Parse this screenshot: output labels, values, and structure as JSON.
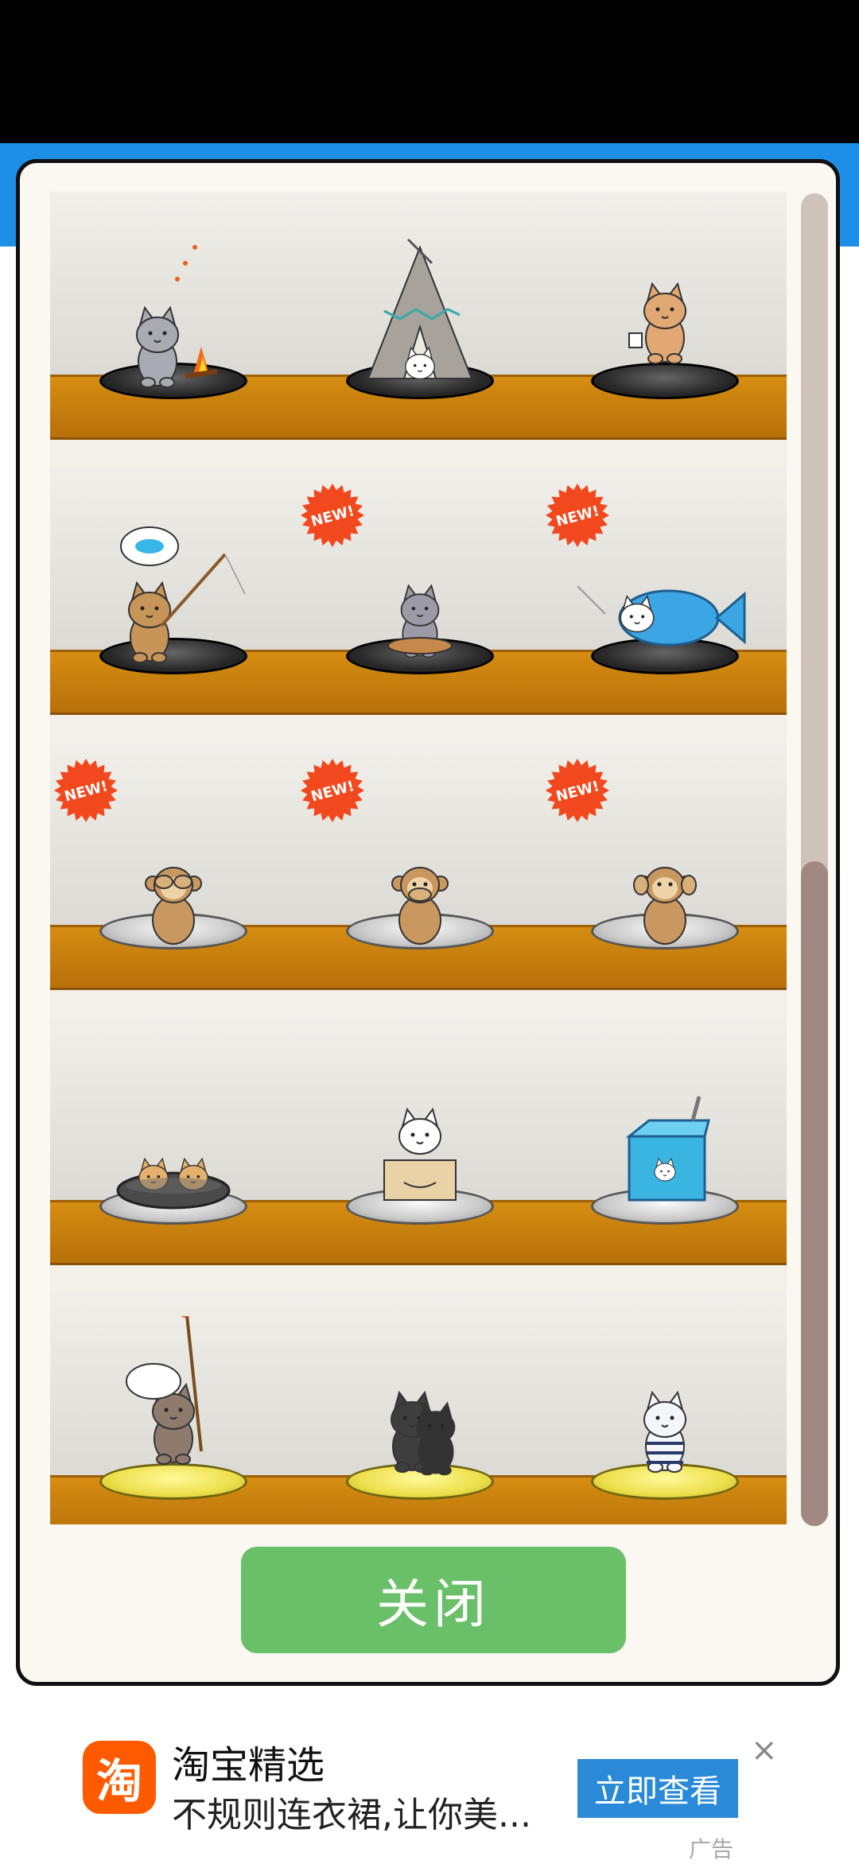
{
  "shelf_rows": [
    {
      "platform": "black",
      "items": [
        {
          "name": "campfire-cat",
          "is_new": false
        },
        {
          "name": "tent-cat",
          "is_new": false
        },
        {
          "name": "coffee-cat",
          "is_new": false
        }
      ]
    },
    {
      "platform": "black",
      "items": [
        {
          "name": "fishing-cat",
          "is_new": false
        },
        {
          "name": "dining-cat",
          "is_new": true
        },
        {
          "name": "fish-costume-cat",
          "is_new": true
        }
      ]
    },
    {
      "platform": "silver",
      "items": [
        {
          "name": "see-no-evil-monkey",
          "is_new": true
        },
        {
          "name": "speak-no-evil-monkey",
          "is_new": true
        },
        {
          "name": "hear-no-evil-monkey",
          "is_new": true
        }
      ]
    },
    {
      "platform": "silver",
      "items": [
        {
          "name": "hotpot-cats",
          "is_new": false
        },
        {
          "name": "box-cat",
          "is_new": false
        },
        {
          "name": "juice-box",
          "is_new": false
        }
      ]
    },
    {
      "platform": "gold",
      "items": [
        {
          "name": "chef-cat",
          "is_new": false
        },
        {
          "name": "black-cats",
          "is_new": false
        },
        {
          "name": "striped-cat",
          "is_new": false
        }
      ]
    }
  ],
  "new_badge_text": "NEW!",
  "close_button_label": "关闭",
  "ad": {
    "logo_text": "淘",
    "title": "淘宝精选",
    "description": "不规则连衣裙,让你美...",
    "button_label": "立即查看",
    "close_symbol": "×",
    "label": "广告"
  },
  "colors": {
    "close_button": "#6abf69",
    "shelf": "#c97d0d",
    "new_badge": "#f2481e",
    "ad_button": "#2a8ad8",
    "ad_logo": "#ff5a00"
  }
}
